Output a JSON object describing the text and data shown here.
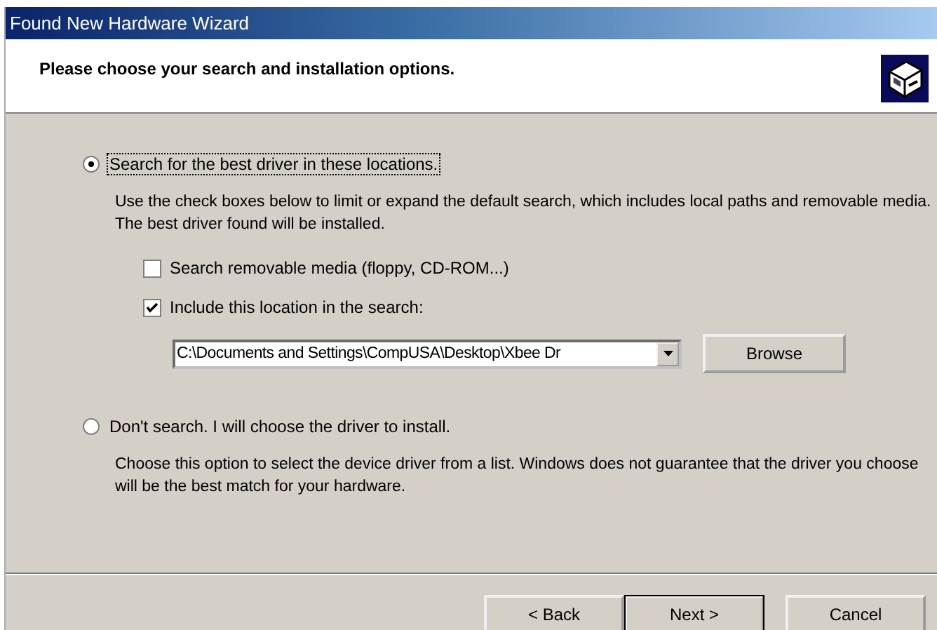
{
  "window": {
    "title": "Found New Hardware Wizard"
  },
  "header": {
    "heading": "Please choose your search and installation options."
  },
  "options": [
    {
      "label": "Search for the best driver in these locations.",
      "selected": true,
      "focused": true,
      "description": "Use the check boxes below to limit or expand the default search, which includes local paths and removable media. The best driver found will be installed.",
      "checkboxes": [
        {
          "label": "Search removable media (floppy, CD-ROM...)",
          "checked": false
        },
        {
          "label": "Include this location in the search:",
          "checked": true
        }
      ],
      "location": {
        "value": "C:\\Documents and Settings\\CompUSA\\Desktop\\Xbee Dr",
        "button": "Browse"
      }
    },
    {
      "label": "Don't search. I will choose the driver to install.",
      "selected": false,
      "focused": false,
      "description": "Choose this option to select the device driver from a list.  Windows does not guarantee that the driver you choose will be the best match for your hardware."
    }
  ],
  "buttons": [
    {
      "label": "< Back",
      "default": false
    },
    {
      "label": "Next >",
      "default": true
    },
    {
      "label": "Cancel",
      "default": false
    }
  ]
}
